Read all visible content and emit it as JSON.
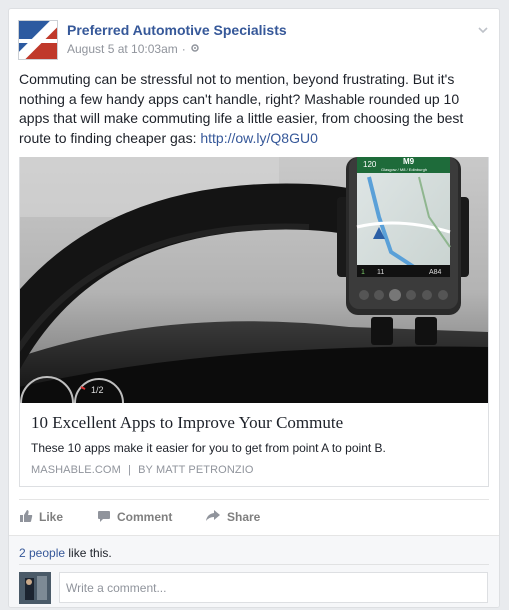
{
  "post": {
    "page_name": "Preferred Automotive Specialists",
    "timestamp": "August 5 at 10:03am",
    "separator": "·",
    "text": "Commuting can be stressful not to mention, beyond frustrating. But it's nothing a few handy apps can't handle, right? Mashable rounded up 10 apps that will make commuting life a little easier, from choosing the best route to finding cheaper gas:",
    "link_text": "http://ow.ly/Q8GU0"
  },
  "attachment": {
    "title": "10 Excellent Apps to Improve Your Commute",
    "description": "These 10 apps make it easier for you to get from point A to point B.",
    "source": "MASHABLE.COM",
    "divider": "|",
    "author": "BY MATT PETRONZIO",
    "phone_screen": {
      "route": "M9",
      "street": "Glasgow / M8 / Edinburgh",
      "top_left": "120",
      "bottom_left": "1",
      "bottom_mid": "11",
      "bottom_right": "A84"
    },
    "gauge_label": "1/2"
  },
  "actions": {
    "like": "Like",
    "comment": "Comment",
    "share": "Share"
  },
  "likes": {
    "count": "2 people",
    "suffix": " like this."
  },
  "comment": {
    "placeholder": "Write a comment..."
  }
}
